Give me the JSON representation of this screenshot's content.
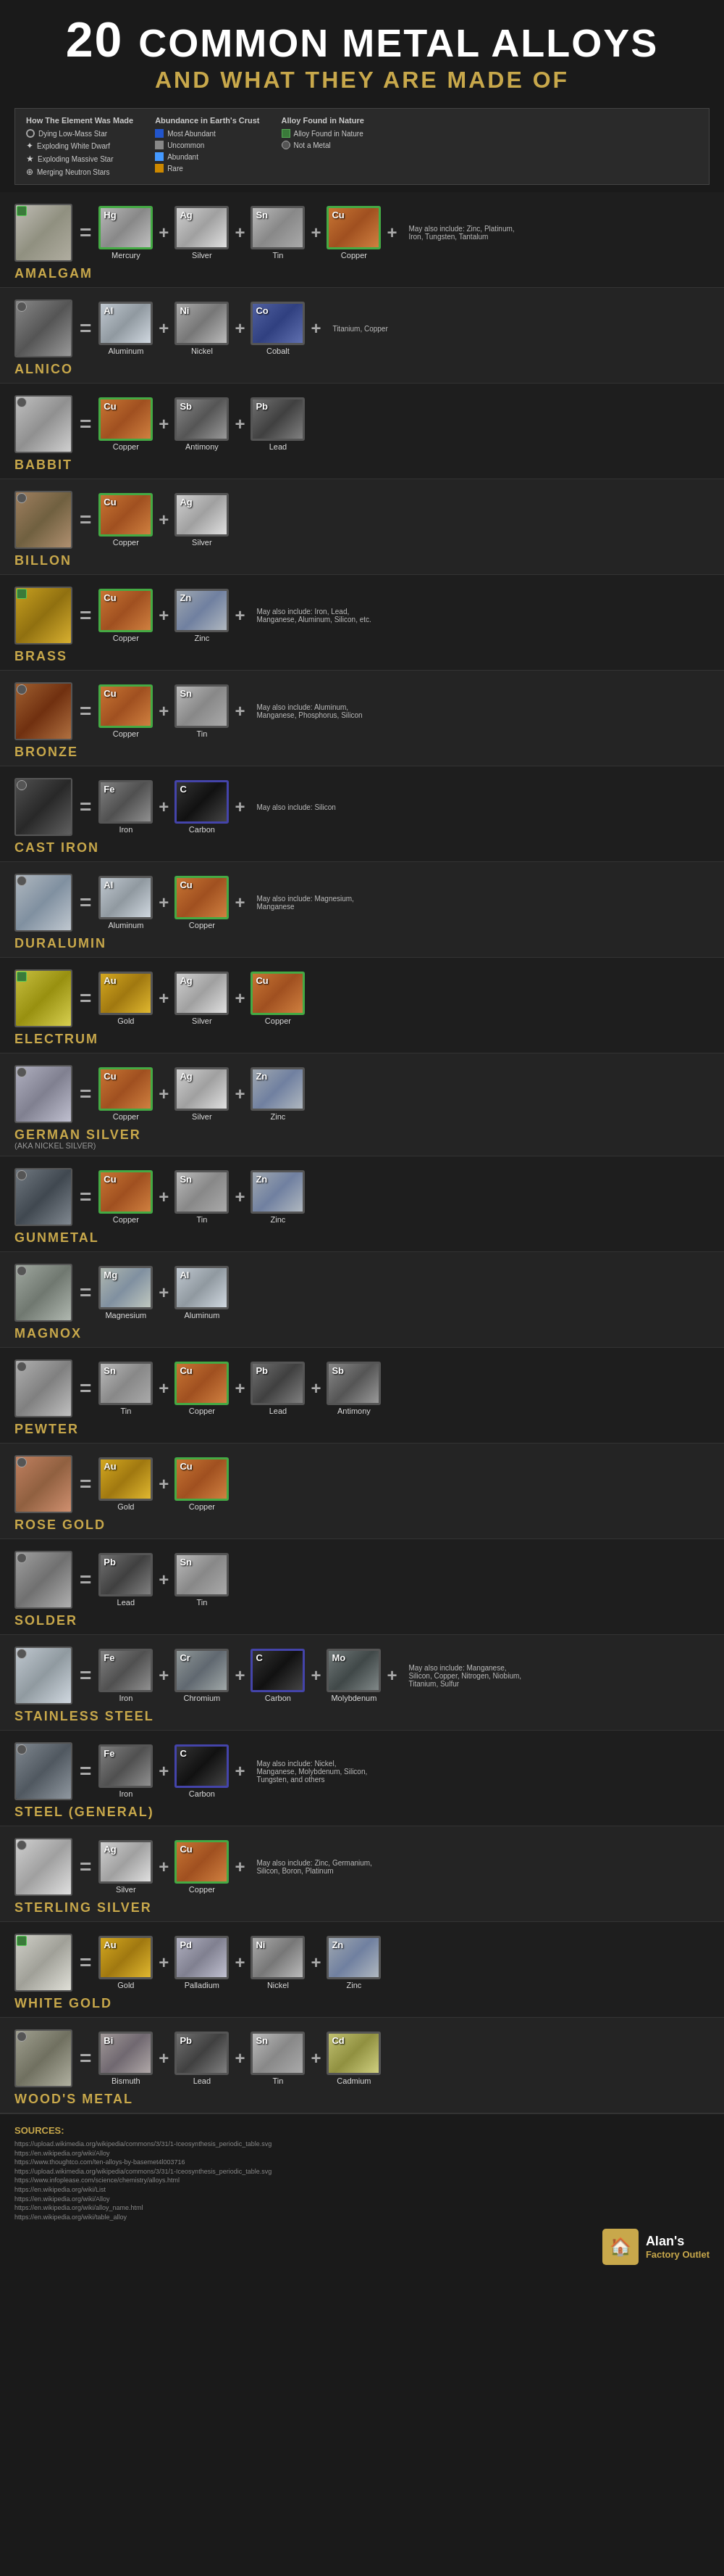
{
  "header": {
    "number": "20",
    "title_top": "COMMON METAL ALLOYS",
    "title_bottom": "AND WHAT THEY ARE MADE OF"
  },
  "legend": {
    "how_made_title": "How The Element Was Made",
    "how_made_items": [
      {
        "icon": "circle",
        "label": "Dying Low-Mass Star"
      },
      {
        "icon": "star",
        "label": "Exploding White Dwarf"
      },
      {
        "icon": "star2",
        "label": "Exploding Massive Star"
      },
      {
        "icon": "merge",
        "label": "Merging Neutron Stars"
      }
    ],
    "abundance_title": "Abundance in Earth's Crust",
    "abundance_items": [
      {
        "color": "#2255cc",
        "label": "Most Abundant"
      },
      {
        "color": "#888",
        "label": "Uncommon"
      },
      {
        "color": "#4499ff",
        "label": "Abundant"
      },
      {
        "color": "#cc8800",
        "label": "Rare"
      }
    ],
    "alloy_nature_title": "Alloy Found in Nature",
    "alloy_nature_yes": "Alloy Found in Nature",
    "alloy_nature_no": "Not a Metal"
  },
  "alloys": [
    {
      "id": "amalgam",
      "name": "AMALGAM",
      "subtitle": "",
      "found_nature": true,
      "sample_class": "swatch-amalgam",
      "elements": [
        {
          "symbol": "Hg",
          "name": "Mercury",
          "class": "swatch-mercury",
          "border": "green-border"
        },
        {
          "symbol": "Ag",
          "name": "Silver",
          "class": "swatch-silver",
          "border": "dark-border"
        },
        {
          "symbol": "Sn",
          "name": "Tin",
          "class": "swatch-tin",
          "border": "dark-border"
        },
        {
          "symbol": "Cu",
          "name": "Copper",
          "class": "swatch-copper",
          "border": "green-border"
        }
      ],
      "may_also": "May also include: Zinc, Platinum, Iron, Tungsten, Tantalum"
    },
    {
      "id": "alnico",
      "name": "ALNICO",
      "subtitle": "",
      "found_nature": false,
      "sample_class": "swatch-alnico",
      "elements": [
        {
          "symbol": "Al",
          "name": "Aluminum",
          "class": "swatch-aluminum",
          "border": "dark-border"
        },
        {
          "symbol": "Ni",
          "name": "Nickel",
          "class": "swatch-nickel",
          "border": "dark-border"
        },
        {
          "symbol": "Co",
          "name": "Cobalt",
          "class": "swatch-cobalt",
          "border": "dark-border"
        }
      ],
      "may_also": "Titanium, Copper"
    },
    {
      "id": "babbit",
      "name": "BABBIT",
      "subtitle": "",
      "found_nature": false,
      "sample_class": "swatch-babbit",
      "elements": [
        {
          "symbol": "Cu",
          "name": "Copper",
          "class": "swatch-copper",
          "border": "green-border"
        },
        {
          "symbol": "Sb",
          "name": "Antimony",
          "class": "swatch-antimony",
          "border": "dark-border"
        },
        {
          "symbol": "Pb",
          "name": "Lead",
          "class": "swatch-lead",
          "border": "dark-border"
        }
      ],
      "may_also": ""
    },
    {
      "id": "billon",
      "name": "BILLON",
      "subtitle": "",
      "found_nature": false,
      "sample_class": "swatch-billon",
      "elements": [
        {
          "symbol": "Cu",
          "name": "Copper",
          "class": "swatch-copper",
          "border": "green-border"
        },
        {
          "symbol": "Ag",
          "name": "Silver",
          "class": "swatch-silver",
          "border": "dark-border"
        }
      ],
      "may_also": ""
    },
    {
      "id": "brass",
      "name": "BRASS",
      "subtitle": "",
      "found_nature": true,
      "sample_class": "swatch-brass",
      "elements": [
        {
          "symbol": "Cu",
          "name": "Copper",
          "class": "swatch-copper",
          "border": "green-border"
        },
        {
          "symbol": "Zn",
          "name": "Zinc",
          "class": "swatch-zinc",
          "border": "dark-border"
        }
      ],
      "may_also": "May also include: Iron, Lead, Manganese, Aluminum, Silicon, etc."
    },
    {
      "id": "bronze",
      "name": "BRONZE",
      "subtitle": "",
      "found_nature": false,
      "sample_class": "swatch-bronze",
      "elements": [
        {
          "symbol": "Cu",
          "name": "Copper",
          "class": "swatch-copper",
          "border": "green-border"
        },
        {
          "symbol": "Sn",
          "name": "Tin",
          "class": "swatch-tin",
          "border": "dark-border"
        }
      ],
      "may_also": "May also include: Aluminum, Manganese, Phosphorus, Silicon"
    },
    {
      "id": "castiron",
      "name": "CAST IRON",
      "subtitle": "",
      "found_nature": false,
      "sample_class": "swatch-castiron",
      "elements": [
        {
          "symbol": "Fe",
          "name": "Iron",
          "class": "swatch-iron",
          "border": "dark-border"
        },
        {
          "symbol": "C",
          "name": "Carbon",
          "class": "swatch-carbon",
          "border": "blue-border"
        }
      ],
      "may_also": "May also include: Silicon"
    },
    {
      "id": "duralumin",
      "name": "DURALUMIN",
      "subtitle": "",
      "found_nature": false,
      "sample_class": "swatch-duralumin",
      "elements": [
        {
          "symbol": "Al",
          "name": "Aluminum",
          "class": "swatch-aluminum",
          "border": "dark-border"
        },
        {
          "symbol": "Cu",
          "name": "Copper",
          "class": "swatch-copper",
          "border": "green-border"
        }
      ],
      "may_also": "May also include: Magnesium, Manganese"
    },
    {
      "id": "electrum",
      "name": "ELECTRUM",
      "subtitle": "",
      "found_nature": true,
      "sample_class": "swatch-electrum",
      "elements": [
        {
          "symbol": "Au",
          "name": "Gold",
          "class": "swatch-gold",
          "border": "dark-border"
        },
        {
          "symbol": "Ag",
          "name": "Silver",
          "class": "swatch-silver",
          "border": "dark-border"
        },
        {
          "symbol": "Cu",
          "name": "Copper",
          "class": "swatch-copper",
          "border": "green-border"
        }
      ],
      "may_also": ""
    },
    {
      "id": "germansilver",
      "name": "GERMAN SILVER",
      "subtitle": "(AKA NICKEL SILVER)",
      "found_nature": false,
      "sample_class": "swatch-germansilver",
      "elements": [
        {
          "symbol": "Cu",
          "name": "Copper",
          "class": "swatch-copper",
          "border": "green-border"
        },
        {
          "symbol": "Ag",
          "name": "Silver",
          "class": "swatch-silver",
          "border": "dark-border"
        },
        {
          "symbol": "Zn",
          "name": "Zinc",
          "class": "swatch-zinc",
          "border": "dark-border"
        }
      ],
      "may_also": ""
    },
    {
      "id": "gunmetal",
      "name": "GUNMETAL",
      "subtitle": "",
      "found_nature": false,
      "sample_class": "swatch-gunmetal",
      "elements": [
        {
          "symbol": "Cu",
          "name": "Copper",
          "class": "swatch-copper",
          "border": "green-border"
        },
        {
          "symbol": "Sn",
          "name": "Tin",
          "class": "swatch-tin",
          "border": "dark-border"
        },
        {
          "symbol": "Zn",
          "name": "Zinc",
          "class": "swatch-zinc",
          "border": "dark-border"
        }
      ],
      "may_also": ""
    },
    {
      "id": "magnox",
      "name": "MAGNOX",
      "subtitle": "",
      "found_nature": false,
      "sample_class": "swatch-magnox",
      "elements": [
        {
          "symbol": "Mg",
          "name": "Magnesium",
          "class": "swatch-magnesium",
          "border": "dark-border"
        },
        {
          "symbol": "Al",
          "name": "Aluminum",
          "class": "swatch-aluminum",
          "border": "dark-border"
        }
      ],
      "may_also": ""
    },
    {
      "id": "pewter",
      "name": "PEWTER",
      "subtitle": "",
      "found_nature": false,
      "sample_class": "swatch-pewter",
      "elements": [
        {
          "symbol": "Sn",
          "name": "Tin",
          "class": "swatch-tin",
          "border": "dark-border"
        },
        {
          "symbol": "Cu",
          "name": "Copper",
          "class": "swatch-copper",
          "border": "green-border"
        },
        {
          "symbol": "Pb",
          "name": "Lead",
          "class": "swatch-lead",
          "border": "dark-border"
        },
        {
          "symbol": "Sb",
          "name": "Antimony",
          "class": "swatch-antimony",
          "border": "dark-border"
        }
      ],
      "may_also": ""
    },
    {
      "id": "rosegold",
      "name": "ROSE GOLD",
      "subtitle": "",
      "found_nature": false,
      "sample_class": "swatch-rosegold",
      "elements": [
        {
          "symbol": "Au",
          "name": "Gold",
          "class": "swatch-gold",
          "border": "dark-border"
        },
        {
          "symbol": "Cu",
          "name": "Copper",
          "class": "swatch-copper",
          "border": "green-border"
        }
      ],
      "may_also": ""
    },
    {
      "id": "solder",
      "name": "SOLDER",
      "subtitle": "",
      "found_nature": false,
      "sample_class": "swatch-solder",
      "elements": [
        {
          "symbol": "Pb",
          "name": "Lead",
          "class": "swatch-lead",
          "border": "dark-border"
        },
        {
          "symbol": "Sn",
          "name": "Tin",
          "class": "swatch-tin",
          "border": "dark-border"
        }
      ],
      "may_also": ""
    },
    {
      "id": "stainlesssteel",
      "name": "STAINLESS STEEL",
      "subtitle": "",
      "found_nature": false,
      "sample_class": "swatch-stainless",
      "elements": [
        {
          "symbol": "Fe",
          "name": "Iron",
          "class": "swatch-iron",
          "border": "dark-border"
        },
        {
          "symbol": "Cr",
          "name": "Chromium",
          "class": "swatch-chromium",
          "border": "dark-border"
        },
        {
          "symbol": "C",
          "name": "Carbon",
          "class": "swatch-carbon",
          "border": "blue-border"
        },
        {
          "symbol": "Mo",
          "name": "Molybdenum",
          "class": "swatch-molybdenum",
          "border": "dark-border"
        }
      ],
      "may_also": "May also include: Manganese, Silicon, Copper, Nitrogen, Niobium, Titanium, Sulfur"
    },
    {
      "id": "steelgeneral",
      "name": "STEEL (GENERAL)",
      "subtitle": "",
      "found_nature": false,
      "sample_class": "swatch-steel",
      "elements": [
        {
          "symbol": "Fe",
          "name": "Iron",
          "class": "swatch-iron",
          "border": "dark-border"
        },
        {
          "symbol": "C",
          "name": "Carbon",
          "class": "swatch-carbon",
          "border": "blue-border"
        }
      ],
      "may_also": "May also include: Nickel, Manganese, Molybdenum, Silicon, Tungsten, and others"
    },
    {
      "id": "sterlingsilver",
      "name": "STERLING SILVER",
      "subtitle": "",
      "found_nature": false,
      "sample_class": "swatch-sterlingsilver",
      "elements": [
        {
          "symbol": "Ag",
          "name": "Silver",
          "class": "swatch-silver",
          "border": "dark-border"
        },
        {
          "symbol": "Cu",
          "name": "Copper",
          "class": "swatch-copper",
          "border": "green-border"
        }
      ],
      "may_also": "May also include: Zinc, Germanium, Silicon, Boron, Platinum"
    },
    {
      "id": "whitegold",
      "name": "WHITE GOLD",
      "subtitle": "",
      "found_nature": true,
      "sample_class": "swatch-whitegold",
      "elements": [
        {
          "symbol": "Au",
          "name": "Gold",
          "class": "swatch-gold",
          "border": "dark-border"
        },
        {
          "symbol": "Pd",
          "name": "Palladium",
          "class": "swatch-palladium",
          "border": "dark-border"
        },
        {
          "symbol": "Ni",
          "name": "Nickel",
          "class": "swatch-nickel",
          "border": "dark-border"
        },
        {
          "symbol": "Zn",
          "name": "Zinc",
          "class": "swatch-zinc",
          "border": "dark-border"
        }
      ],
      "may_also": ""
    },
    {
      "id": "woodsmetal",
      "name": "WOOD'S METAL",
      "subtitle": "",
      "found_nature": false,
      "sample_class": "swatch-woodsmetal",
      "elements": [
        {
          "symbol": "Bi",
          "name": "Bismuth",
          "class": "swatch-bismuth",
          "border": "dark-border"
        },
        {
          "symbol": "Pb",
          "name": "Lead",
          "class": "swatch-lead",
          "border": "dark-border"
        },
        {
          "symbol": "Sn",
          "name": "Tin",
          "class": "swatch-tin",
          "border": "dark-border"
        },
        {
          "symbol": "Cd",
          "name": "Cadmium",
          "class": "swatch-cadmium",
          "border": "dark-border"
        }
      ],
      "may_also": ""
    }
  ],
  "sources": {
    "title": "SOURCES:",
    "links": [
      "https://upload.wikimedia.org/wikipedia/commons/3/31/1-Iceosynthesis_periodic_table.svg",
      "https://en.wikipedia.org/wiki/Alloy",
      "https://www.thoughtco.com/ten-alloys-by-basemet4l003716",
      "https://upload.wikimedia.org/wikipedia/commons/3/31/1-Iceosynthesis_periodic_table.svg",
      "https://www.infoplease.com/science/chemistry/alloys.html",
      "https://en.wikipedia.org/wiki/List",
      "https://en.wikipedia.org/wiki/Alloy",
      "https://en.wikipedia.org/wiki/alloy_name.html",
      "https://en.wikipedia.org/wiki/table_alloy"
    ]
  },
  "brand": {
    "name": "Alan's",
    "sub": "Factory Outlet",
    "icon": "🏠"
  }
}
